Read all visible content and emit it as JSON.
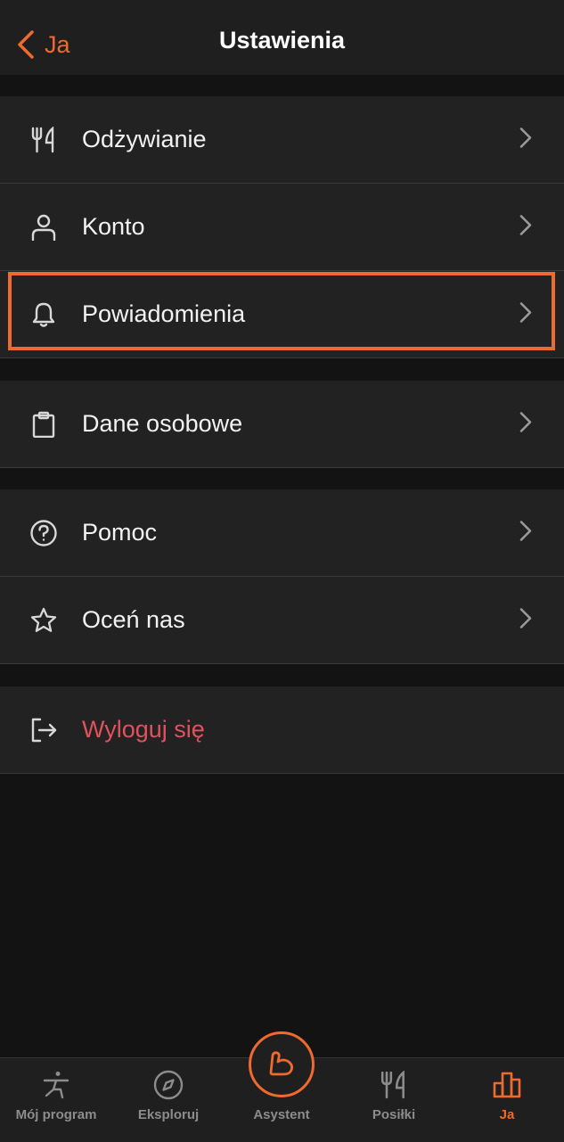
{
  "header": {
    "back_label": "Ja",
    "title": "Ustawienia"
  },
  "groups": [
    {
      "items": [
        {
          "label": "Odżywianie",
          "icon": "fork-knife-icon"
        },
        {
          "label": "Konto",
          "icon": "person-icon"
        },
        {
          "label": "Powiadomienia",
          "icon": "bell-icon",
          "highlighted": true
        }
      ]
    },
    {
      "items": [
        {
          "label": "Dane osobowe",
          "icon": "clipboard-icon"
        }
      ]
    },
    {
      "items": [
        {
          "label": "Pomoc",
          "icon": "help-circle-icon"
        },
        {
          "label": "Oceń nas",
          "icon": "star-icon"
        }
      ]
    },
    {
      "items": [
        {
          "label": "Wyloguj się",
          "icon": "logout-icon"
        }
      ]
    }
  ],
  "tabbar": {
    "tabs": [
      {
        "label": "Mój program",
        "icon": "yoga-figure-icon"
      },
      {
        "label": "Eksploruj",
        "icon": "compass-icon"
      },
      {
        "label": "Asystent",
        "icon": "flexed-arm-icon"
      },
      {
        "label": "Posiłki",
        "icon": "fork-knife-icon"
      },
      {
        "label": "Ja",
        "icon": "bar-chart-icon",
        "active": true
      }
    ]
  },
  "colors": {
    "accent": "#ef6a2e",
    "danger": "#e0525d",
    "background": "#131313",
    "surface": "#222222"
  }
}
